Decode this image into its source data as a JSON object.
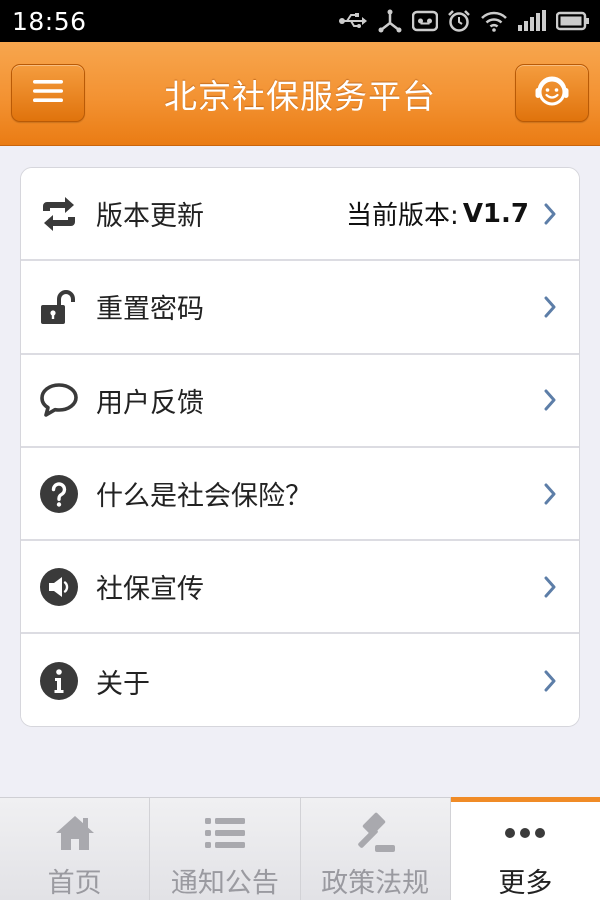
{
  "status_bar": {
    "time": "18:56",
    "icons": [
      "usb-icon",
      "usb-debug-icon",
      "voicemail-icon",
      "alarm-icon",
      "wifi-icon",
      "signal-icon",
      "battery-icon"
    ]
  },
  "header": {
    "title": "北京社保服务平台",
    "left_icon": "menu-icon",
    "right_icon": "customer-service-icon"
  },
  "menu": {
    "items": [
      {
        "label": "版本更新",
        "icon": "refresh-icon",
        "value_label": "当前版本:",
        "value": "V1.7"
      },
      {
        "label": "重置密码",
        "icon": "unlock-icon"
      },
      {
        "label": "用户反馈",
        "icon": "chat-bubble-icon"
      },
      {
        "label": "什么是社会保险？",
        "icon": "question-icon"
      },
      {
        "label": "社保宣传",
        "icon": "speaker-icon"
      },
      {
        "label": "关于",
        "icon": "info-icon"
      }
    ]
  },
  "tab_bar": {
    "tabs": [
      {
        "label": "首页",
        "icon": "home-icon",
        "active": false
      },
      {
        "label": "通知公告",
        "icon": "list-icon",
        "active": false
      },
      {
        "label": "政策法规",
        "icon": "gavel-icon",
        "active": false
      },
      {
        "label": "更多",
        "icon": "more-icon",
        "active": true
      }
    ]
  },
  "colors": {
    "accent": "#f39232",
    "header_dark": "#ea7c14",
    "chevron": "#5d7ea8",
    "icon": "#3a3a3a",
    "tab_inactive": "#9a9aa0"
  }
}
